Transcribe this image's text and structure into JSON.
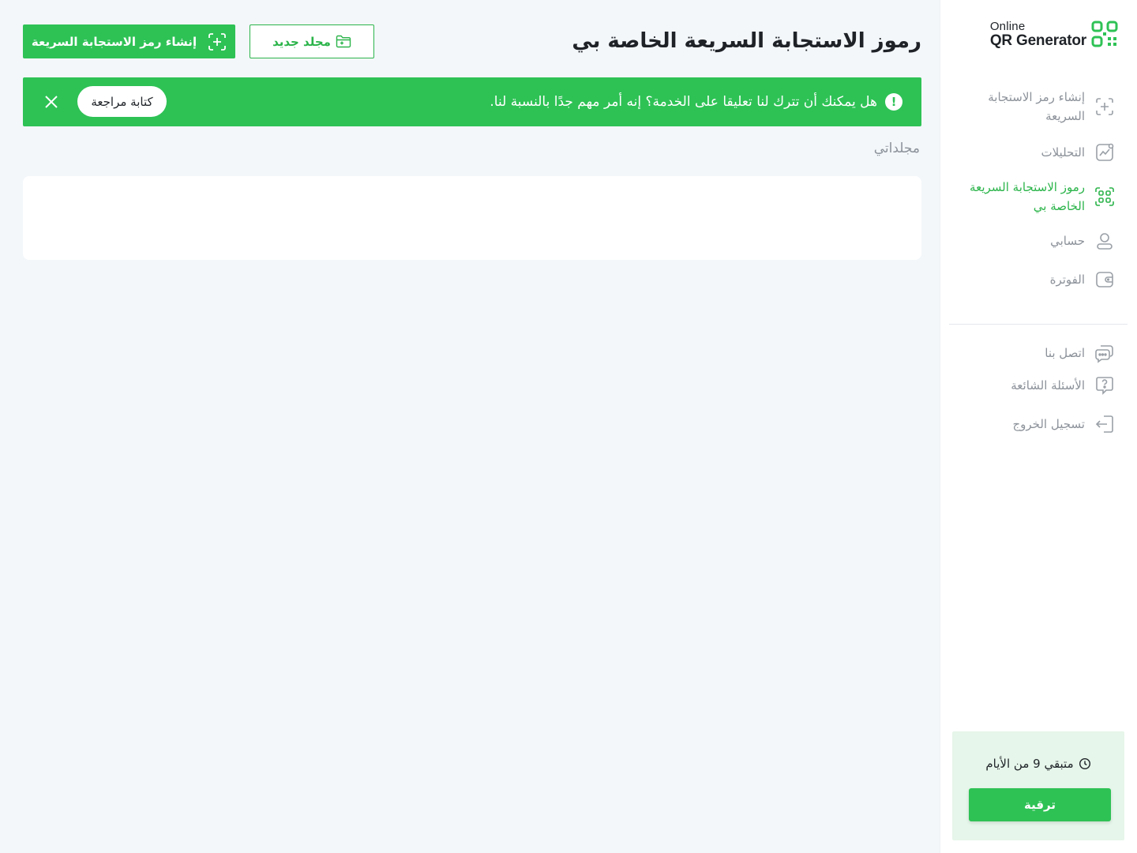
{
  "brand": {
    "logo_line1": "Online",
    "logo_line2": "QR Generator",
    "accent_color": "#2ec255"
  },
  "sidebar": {
    "items": [
      {
        "label": "إنشاء رمز الاستجابة السريعة",
        "icon": "create-qr-icon",
        "active": false
      },
      {
        "label": "التحليلات",
        "icon": "analytics-icon",
        "active": false
      },
      {
        "label": "رموز الاستجابة السريعة الخاصة بي",
        "icon": "qr-codes-icon",
        "active": true
      },
      {
        "label": "حسابي",
        "icon": "user-icon",
        "active": false
      },
      {
        "label": "الفوترة",
        "icon": "wallet-icon",
        "active": false
      },
      {
        "label": "اتصل بنا",
        "icon": "chat-icon",
        "active": false
      },
      {
        "label": "الأسئلة الشائعة",
        "icon": "faq-icon",
        "active": false
      },
      {
        "label": "تسجيل الخروج",
        "icon": "logout-icon",
        "active": false
      }
    ],
    "trial": {
      "days_left_text": "متبقي 9 من الأيام",
      "upgrade_label": "ترقية"
    }
  },
  "header": {
    "title": "رموز الاستجابة السريعة الخاصة بي",
    "new_folder_label": "مجلد جديد",
    "create_qr_label": "إنشاء رمز الاستجابة السريعة"
  },
  "banner": {
    "message": "هل يمكنك أن تترك لنا تعليقا على الخدمة؟ إنه أمر مهم جدًا بالنسبة لنا.",
    "review_label": "كتابة مراجعة"
  },
  "folders": {
    "label": "مجلداتي"
  }
}
